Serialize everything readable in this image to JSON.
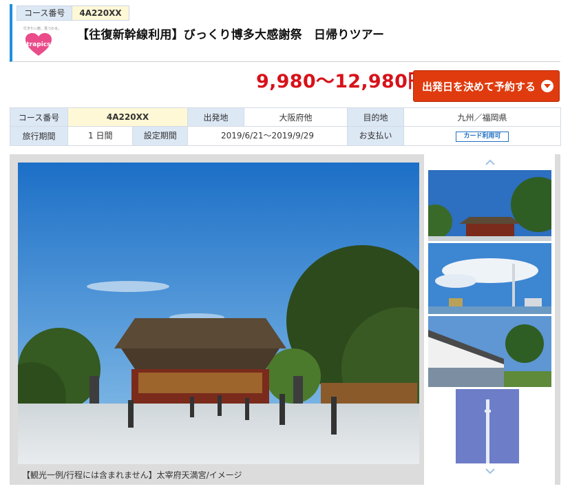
{
  "header": {
    "course_label": "コース番号",
    "course_code": "4A220XX",
    "logo_tagline": "行きたい旅、見つかる。",
    "logo_text": "trapics",
    "title": "【往復新幹線利用】びっくり博多大感謝祭　日帰りツアー"
  },
  "price": "9,980〜12,980円",
  "book_button": {
    "label": "出発日を決めて予約する",
    "icon": "chevron-down-icon"
  },
  "info": {
    "course_label": "コース番号",
    "course_value": "4A220XX",
    "depart_label": "出発地",
    "depart_value": "大阪府他",
    "dest_label": "目的地",
    "dest_value": "九州／福岡県",
    "period_label": "旅行期間",
    "period_value": "1 日間",
    "setting_label": "設定期間",
    "setting_value": "2019/6/21〜2019/9/29",
    "payment_label": "お支払い",
    "payment_value": "カード利用可"
  },
  "gallery": {
    "caption": "【観光一例/行程には含まれません】太宰府天満宮/イメージ",
    "thumbnails": [
      "shrine",
      "city-skyline",
      "white-wall-garden",
      "tower"
    ],
    "up_icon": "chevron-up-icon",
    "down_icon": "chevron-down-icon"
  },
  "colors": {
    "accent": "#1e8fe0",
    "price": "#d7121a",
    "button": "#df3b0f"
  }
}
